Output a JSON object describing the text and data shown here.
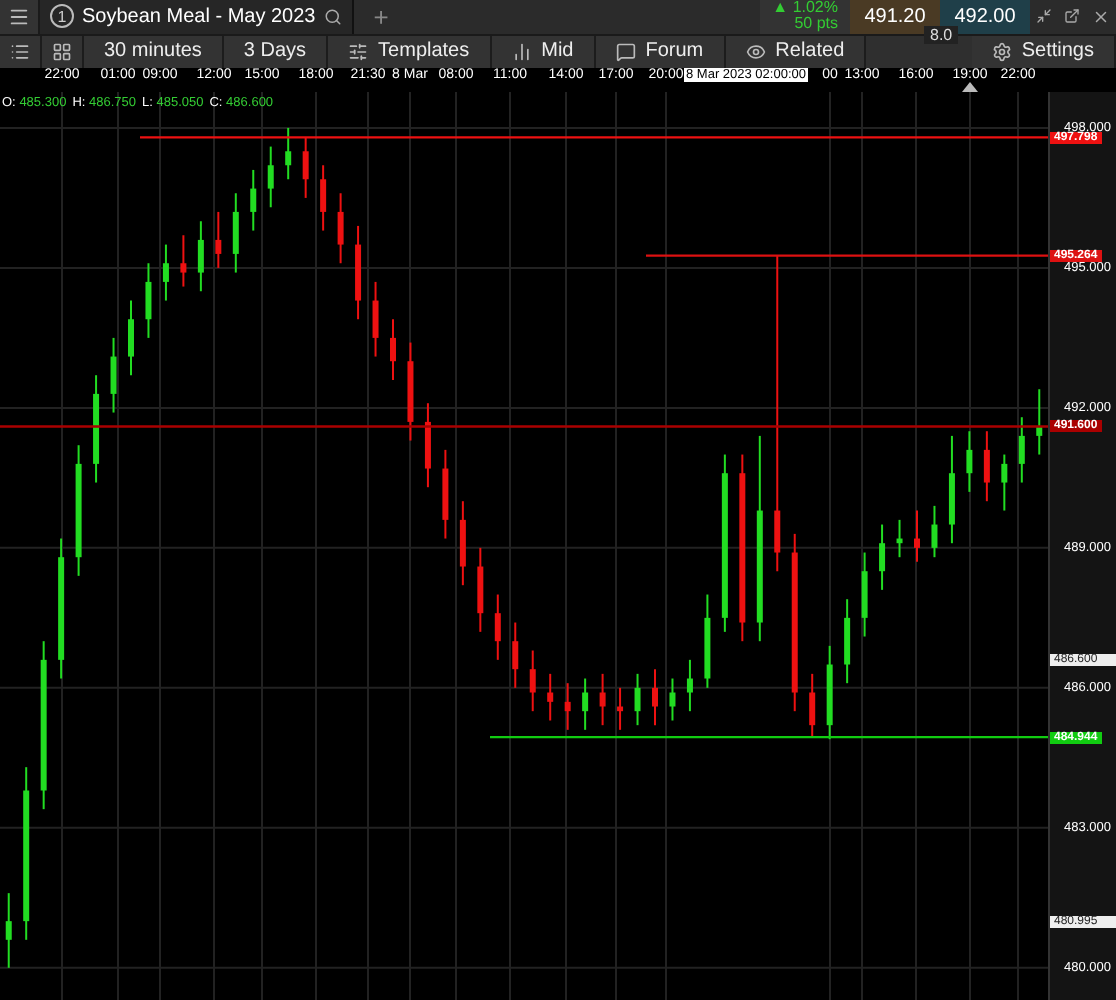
{
  "tab": {
    "number": "1",
    "title": "Soybean Meal - May 2023",
    "add": "+"
  },
  "quote": {
    "arrow": "▲",
    "change": "1.02%",
    "points": "50 pts",
    "sell": "491.20",
    "buy": "492.00",
    "spread": "8.0"
  },
  "toolbar": [
    {
      "kind": "list"
    },
    {
      "kind": "layout"
    },
    {
      "kind": "interval",
      "label": "30 minutes"
    },
    {
      "kind": "range",
      "label": "3 Days"
    },
    {
      "kind": "templates",
      "label": "Templates"
    },
    {
      "kind": "price",
      "label": "Mid"
    },
    {
      "kind": "forum",
      "label": "Forum"
    },
    {
      "kind": "related",
      "label": "Related"
    },
    {
      "kind": "settings",
      "label": "Settings"
    }
  ],
  "time_axis": [
    "22:00",
    "01:00",
    "09:00",
    "12:00",
    "15:00",
    "18:00",
    "21:30",
    "8 Mar",
    "08:00",
    "11:00",
    "14:00",
    "17:00",
    "20:00",
    "00",
    "13:00",
    "16:00",
    "19:00",
    "22:00"
  ],
  "crosshair_time": "8 Mar 2023 02:00:00",
  "chart_data": {
    "type": "candlestick",
    "categories": [
      null,
      null,
      null,
      null,
      null,
      null,
      null,
      null,
      null,
      null,
      null,
      null,
      null,
      null,
      null,
      null,
      null,
      null,
      null,
      null,
      null,
      null,
      null,
      null,
      null,
      null,
      null,
      null,
      null,
      null,
      null,
      null,
      null,
      null,
      null,
      null,
      null,
      null,
      null,
      null,
      null,
      null,
      null,
      null,
      null,
      null,
      null,
      null,
      null,
      null,
      null,
      null,
      null,
      null,
      null,
      null,
      null,
      null,
      null,
      null
    ],
    "ylim": [
      479.31,
      498.77
    ],
    "grid": true,
    "ref_lines": [
      {
        "axis": "y",
        "value": 497.798,
        "color": "#ee1111"
      },
      {
        "axis": "y",
        "value": 495.264,
        "color": "#dd1111"
      },
      {
        "axis": "y",
        "value": 491.6,
        "color": "#aa0000"
      },
      {
        "axis": "y",
        "value": 484.944,
        "color": "#11cc11"
      }
    ],
    "yticks": [
      {
        "value": 498,
        "label": "498.000"
      },
      {
        "value": 495,
        "label": "495.000"
      },
      {
        "value": 492,
        "label": "492.000"
      },
      {
        "value": 489,
        "label": "489.000"
      },
      {
        "value": 486,
        "label": "486.000"
      },
      {
        "value": 483,
        "label": "483.000"
      },
      {
        "value": 480,
        "label": "480.000"
      }
    ],
    "ohlc": [
      [
        480.6,
        481.6,
        480.0,
        481.0
      ],
      [
        481.0,
        484.3,
        480.6,
        483.8
      ],
      [
        483.8,
        487.0,
        483.4,
        486.6
      ],
      [
        486.6,
        489.2,
        486.2,
        488.8
      ],
      [
        488.8,
        491.2,
        488.4,
        490.8
      ],
      [
        490.8,
        492.7,
        490.4,
        492.3
      ],
      [
        492.3,
        493.5,
        491.9,
        493.1
      ],
      [
        493.1,
        494.3,
        492.7,
        493.9
      ],
      [
        493.9,
        495.1,
        493.5,
        494.7
      ],
      [
        494.7,
        495.5,
        494.3,
        495.1
      ],
      [
        495.1,
        495.7,
        494.6,
        494.9
      ],
      [
        494.9,
        496.0,
        494.5,
        495.6
      ],
      [
        495.6,
        496.2,
        495.0,
        495.3
      ],
      [
        495.3,
        496.6,
        494.9,
        496.2
      ],
      [
        496.2,
        497.1,
        495.8,
        496.7
      ],
      [
        496.7,
        497.6,
        496.3,
        497.2
      ],
      [
        497.2,
        498.0,
        496.9,
        497.5
      ],
      [
        497.5,
        497.8,
        496.5,
        496.9
      ],
      [
        496.9,
        497.2,
        495.8,
        496.2
      ],
      [
        496.2,
        496.6,
        495.1,
        495.5
      ],
      [
        495.5,
        495.9,
        493.9,
        494.3
      ],
      [
        494.3,
        494.7,
        493.1,
        493.5
      ],
      [
        493.5,
        493.9,
        492.6,
        493.0
      ],
      [
        493.0,
        493.4,
        491.3,
        491.7
      ],
      [
        491.7,
        492.1,
        490.3,
        490.7
      ],
      [
        490.7,
        491.1,
        489.2,
        489.6
      ],
      [
        489.6,
        490.0,
        488.2,
        488.6
      ],
      [
        488.6,
        489.0,
        487.2,
        487.6
      ],
      [
        487.6,
        488.0,
        486.6,
        487.0
      ],
      [
        487.0,
        487.4,
        486.0,
        486.4
      ],
      [
        486.4,
        486.8,
        485.5,
        485.9
      ],
      [
        485.9,
        486.3,
        485.3,
        485.7
      ],
      [
        485.7,
        486.1,
        485.1,
        485.5
      ],
      [
        485.5,
        486.2,
        485.1,
        485.9
      ],
      [
        485.9,
        486.3,
        485.2,
        485.6
      ],
      [
        485.6,
        486.0,
        485.1,
        485.5
      ],
      [
        485.5,
        486.3,
        485.2,
        486.0
      ],
      [
        486.0,
        486.4,
        485.2,
        485.6
      ],
      [
        485.6,
        486.2,
        485.3,
        485.9
      ],
      [
        485.9,
        486.6,
        485.5,
        486.2
      ],
      [
        486.2,
        488.0,
        486.0,
        487.5
      ],
      [
        487.5,
        491.0,
        487.2,
        490.6
      ],
      [
        490.6,
        491.0,
        487.0,
        487.4
      ],
      [
        487.4,
        491.4,
        487.0,
        489.8
      ],
      [
        489.8,
        495.264,
        488.5,
        488.9
      ],
      [
        488.9,
        489.3,
        485.5,
        485.9
      ],
      [
        485.9,
        486.3,
        484.944,
        485.2
      ],
      [
        485.2,
        486.9,
        484.9,
        486.5
      ],
      [
        486.5,
        487.9,
        486.1,
        487.5
      ],
      [
        487.5,
        488.9,
        487.1,
        488.5
      ],
      [
        488.5,
        489.5,
        488.1,
        489.1
      ],
      [
        489.1,
        489.6,
        488.8,
        489.2
      ],
      [
        489.2,
        489.8,
        488.7,
        489.0
      ],
      [
        489.0,
        489.9,
        488.8,
        489.5
      ],
      [
        489.5,
        491.4,
        489.1,
        490.6
      ],
      [
        490.6,
        491.5,
        490.2,
        491.1
      ],
      [
        491.1,
        491.5,
        490.0,
        490.4
      ],
      [
        490.4,
        491.0,
        489.8,
        490.8
      ],
      [
        490.8,
        491.8,
        490.4,
        491.4
      ],
      [
        491.4,
        492.4,
        491.0,
        491.6
      ]
    ]
  },
  "ohlc": [
    {
      "key": "O:",
      "value": "485.300"
    },
    {
      "key": "H:",
      "value": "486.750"
    },
    {
      "key": "L:",
      "value": "485.050"
    },
    {
      "key": "C:",
      "value": "486.600"
    }
  ],
  "price_axis": [
    {
      "kind": "marker",
      "label": "497.798",
      "color": "#ee1111"
    },
    {
      "kind": "marker",
      "label": "495.264",
      "color": "#dd1111"
    },
    {
      "kind": "marker",
      "label": "491.600",
      "color": "#aa0000"
    },
    {
      "kind": "box",
      "label": "486.600"
    },
    {
      "kind": "marker",
      "label": "484.944",
      "color": "#11cc11"
    },
    {
      "kind": "box",
      "label": "480.995"
    }
  ]
}
